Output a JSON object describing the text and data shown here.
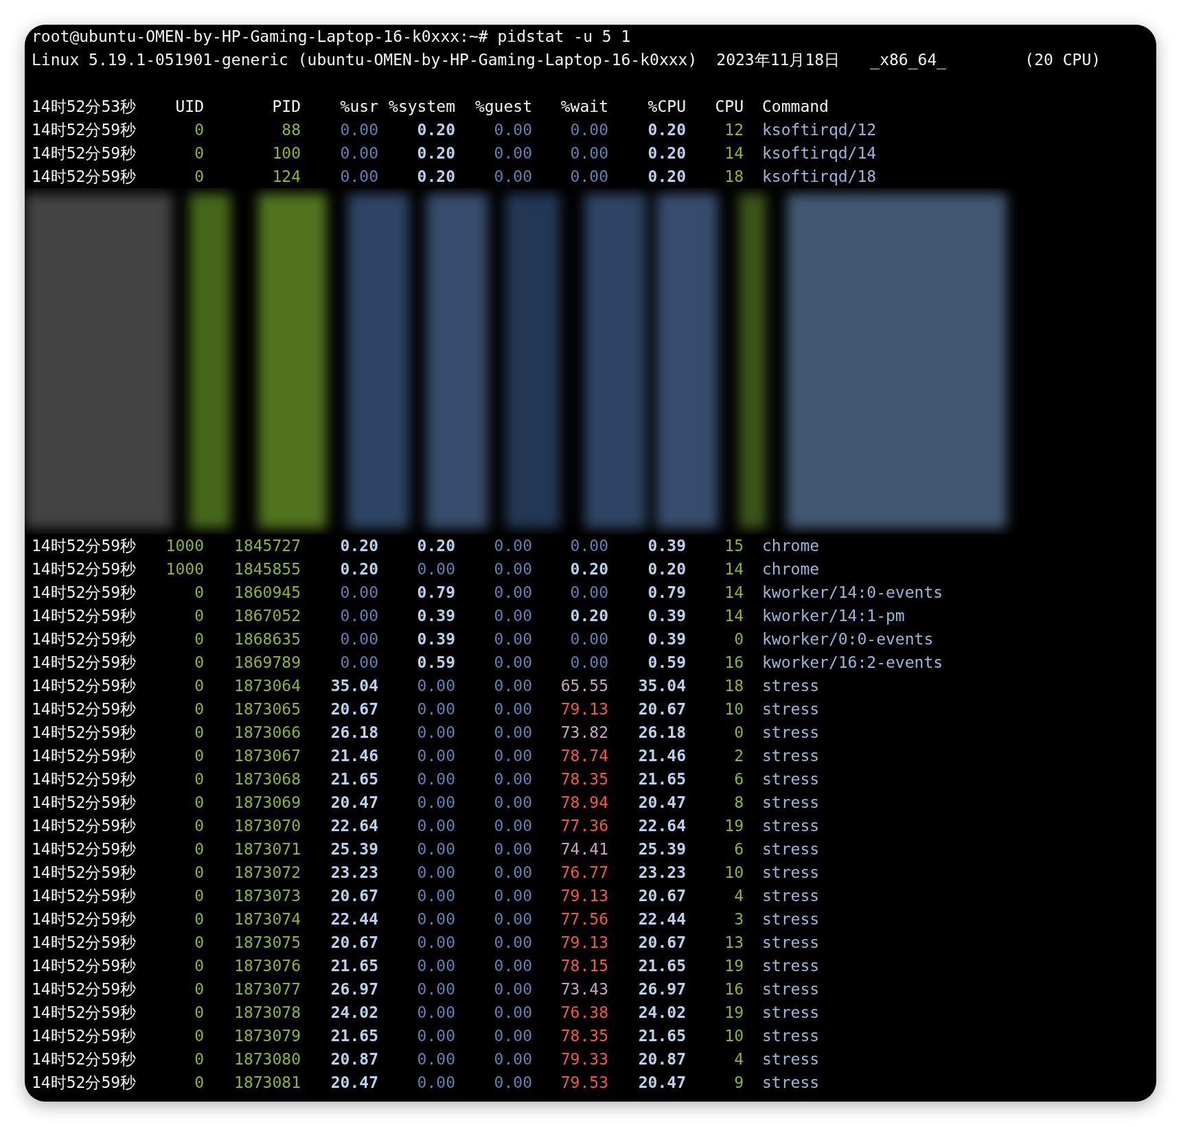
{
  "terminal": {
    "prompt": "root@ubuntu-OMEN-by-HP-Gaming-Laptop-16-k0xxx:~# pidstat -u 5 1",
    "system_info": {
      "kernel": "Linux 5.19.1-051901-generic (ubuntu-OMEN-by-HP-Gaming-Laptop-16-k0xxx)",
      "date": "2023年11月18日",
      "arch": "_x86_64_",
      "cpus": "(20 CPU)"
    },
    "header": [
      "14时52分53秒",
      "UID",
      "PID",
      "%usr",
      "%system",
      "%guest",
      "%wait",
      "%CPU",
      "CPU",
      "Command"
    ],
    "rows": [
      {
        "kind": "process",
        "time": "14时52分59秒",
        "uid": "0",
        "pid": "88",
        "cells": [
          {
            "text": "0.00",
            "kind": "zero"
          },
          {
            "text": "0.20",
            "kind": "value"
          },
          {
            "text": "0.00",
            "kind": "zero"
          },
          {
            "text": "0.00",
            "kind": "zero"
          },
          {
            "text": "0.20",
            "kind": "value"
          }
        ],
        "cpu": "12",
        "command": "ksoftirqd/12"
      },
      {
        "kind": "process",
        "time": "14时52分59秒",
        "uid": "0",
        "pid": "100",
        "cells": [
          {
            "text": "0.00",
            "kind": "zero"
          },
          {
            "text": "0.20",
            "kind": "value"
          },
          {
            "text": "0.00",
            "kind": "zero"
          },
          {
            "text": "0.00",
            "kind": "zero"
          },
          {
            "text": "0.20",
            "kind": "value"
          }
        ],
        "cpu": "14",
        "command": "ksoftirqd/14"
      },
      {
        "kind": "process",
        "time": "14时52分59秒",
        "uid": "0",
        "pid": "124",
        "cells": [
          {
            "text": "0.00",
            "kind": "zero"
          },
          {
            "text": "0.20",
            "kind": "value"
          },
          {
            "text": "0.00",
            "kind": "zero"
          },
          {
            "text": "0.00",
            "kind": "zero"
          },
          {
            "text": "0.20",
            "kind": "value"
          }
        ],
        "cpu": "18",
        "command": "ksoftirqd/18"
      },
      {
        "kind": "blurred"
      },
      {
        "kind": "process",
        "time": "14时52分59秒",
        "uid": "1000",
        "pid": "1845727",
        "cells": [
          {
            "text": "0.20",
            "kind": "value"
          },
          {
            "text": "0.20",
            "kind": "value"
          },
          {
            "text": "0.00",
            "kind": "zero"
          },
          {
            "text": "0.00",
            "kind": "zero"
          },
          {
            "text": "0.39",
            "kind": "value"
          }
        ],
        "cpu": "15",
        "command": "chrome"
      },
      {
        "kind": "process",
        "time": "14时52分59秒",
        "uid": "1000",
        "pid": "1845855",
        "cells": [
          {
            "text": "0.20",
            "kind": "value"
          },
          {
            "text": "0.00",
            "kind": "zero"
          },
          {
            "text": "0.00",
            "kind": "zero"
          },
          {
            "text": "0.20",
            "kind": "value"
          },
          {
            "text": "0.20",
            "kind": "value"
          }
        ],
        "cpu": "14",
        "command": "chrome"
      },
      {
        "kind": "process",
        "time": "14时52分59秒",
        "uid": "0",
        "pid": "1860945",
        "cells": [
          {
            "text": "0.00",
            "kind": "zero"
          },
          {
            "text": "0.79",
            "kind": "value"
          },
          {
            "text": "0.00",
            "kind": "zero"
          },
          {
            "text": "0.00",
            "kind": "zero"
          },
          {
            "text": "0.79",
            "kind": "value"
          }
        ],
        "cpu": "14",
        "command": "kworker/14:0-events"
      },
      {
        "kind": "process",
        "time": "14时52分59秒",
        "uid": "0",
        "pid": "1867052",
        "cells": [
          {
            "text": "0.00",
            "kind": "zero"
          },
          {
            "text": "0.39",
            "kind": "value"
          },
          {
            "text": "0.00",
            "kind": "zero"
          },
          {
            "text": "0.20",
            "kind": "value"
          },
          {
            "text": "0.39",
            "kind": "value"
          }
        ],
        "cpu": "14",
        "command": "kworker/14:1-pm"
      },
      {
        "kind": "process",
        "time": "14时52分59秒",
        "uid": "0",
        "pid": "1868635",
        "cells": [
          {
            "text": "0.00",
            "kind": "zero"
          },
          {
            "text": "0.39",
            "kind": "value"
          },
          {
            "text": "0.00",
            "kind": "zero"
          },
          {
            "text": "0.00",
            "kind": "zero"
          },
          {
            "text": "0.39",
            "kind": "value"
          }
        ],
        "cpu": "0",
        "command": "kworker/0:0-events"
      },
      {
        "kind": "process",
        "time": "14时52分59秒",
        "uid": "0",
        "pid": "1869789",
        "cells": [
          {
            "text": "0.00",
            "kind": "zero"
          },
          {
            "text": "0.59",
            "kind": "value"
          },
          {
            "text": "0.00",
            "kind": "zero"
          },
          {
            "text": "0.00",
            "kind": "zero"
          },
          {
            "text": "0.59",
            "kind": "value"
          }
        ],
        "cpu": "16",
        "command": "kworker/16:2-events"
      },
      {
        "kind": "process",
        "time": "14时52分59秒",
        "uid": "0",
        "pid": "1873064",
        "cells": [
          {
            "text": "35.04",
            "kind": "value"
          },
          {
            "text": "0.00",
            "kind": "zero"
          },
          {
            "text": "0.00",
            "kind": "zero"
          },
          {
            "text": "65.55",
            "kind": "warn"
          },
          {
            "text": "35.04",
            "kind": "value"
          }
        ],
        "cpu": "18",
        "command": "stress"
      },
      {
        "kind": "process",
        "time": "14时52分59秒",
        "uid": "0",
        "pid": "1873065",
        "cells": [
          {
            "text": "20.67",
            "kind": "value"
          },
          {
            "text": "0.00",
            "kind": "zero"
          },
          {
            "text": "0.00",
            "kind": "zero"
          },
          {
            "text": "79.13",
            "kind": "alert"
          },
          {
            "text": "20.67",
            "kind": "value"
          }
        ],
        "cpu": "10",
        "command": "stress"
      },
      {
        "kind": "process",
        "time": "14时52分59秒",
        "uid": "0",
        "pid": "1873066",
        "cells": [
          {
            "text": "26.18",
            "kind": "value"
          },
          {
            "text": "0.00",
            "kind": "zero"
          },
          {
            "text": "0.00",
            "kind": "zero"
          },
          {
            "text": "73.82",
            "kind": "warn"
          },
          {
            "text": "26.18",
            "kind": "value"
          }
        ],
        "cpu": "0",
        "command": "stress"
      },
      {
        "kind": "process",
        "time": "14时52分59秒",
        "uid": "0",
        "pid": "1873067",
        "cells": [
          {
            "text": "21.46",
            "kind": "value"
          },
          {
            "text": "0.00",
            "kind": "zero"
          },
          {
            "text": "0.00",
            "kind": "zero"
          },
          {
            "text": "78.74",
            "kind": "alert"
          },
          {
            "text": "21.46",
            "kind": "value"
          }
        ],
        "cpu": "2",
        "command": "stress"
      },
      {
        "kind": "process",
        "time": "14时52分59秒",
        "uid": "0",
        "pid": "1873068",
        "cells": [
          {
            "text": "21.65",
            "kind": "value"
          },
          {
            "text": "0.00",
            "kind": "zero"
          },
          {
            "text": "0.00",
            "kind": "zero"
          },
          {
            "text": "78.35",
            "kind": "alert"
          },
          {
            "text": "21.65",
            "kind": "value"
          }
        ],
        "cpu": "6",
        "command": "stress"
      },
      {
        "kind": "process",
        "time": "14时52分59秒",
        "uid": "0",
        "pid": "1873069",
        "cells": [
          {
            "text": "20.47",
            "kind": "value"
          },
          {
            "text": "0.00",
            "kind": "zero"
          },
          {
            "text": "0.00",
            "kind": "zero"
          },
          {
            "text": "78.94",
            "kind": "alert"
          },
          {
            "text": "20.47",
            "kind": "value"
          }
        ],
        "cpu": "8",
        "command": "stress"
      },
      {
        "kind": "process",
        "time": "14时52分59秒",
        "uid": "0",
        "pid": "1873070",
        "cells": [
          {
            "text": "22.64",
            "kind": "value"
          },
          {
            "text": "0.00",
            "kind": "zero"
          },
          {
            "text": "0.00",
            "kind": "zero"
          },
          {
            "text": "77.36",
            "kind": "alert"
          },
          {
            "text": "22.64",
            "kind": "value"
          }
        ],
        "cpu": "19",
        "command": "stress"
      },
      {
        "kind": "process",
        "time": "14时52分59秒",
        "uid": "0",
        "pid": "1873071",
        "cells": [
          {
            "text": "25.39",
            "kind": "value"
          },
          {
            "text": "0.00",
            "kind": "zero"
          },
          {
            "text": "0.00",
            "kind": "zero"
          },
          {
            "text": "74.41",
            "kind": "warn"
          },
          {
            "text": "25.39",
            "kind": "value"
          }
        ],
        "cpu": "6",
        "command": "stress"
      },
      {
        "kind": "process",
        "time": "14时52分59秒",
        "uid": "0",
        "pid": "1873072",
        "cells": [
          {
            "text": "23.23",
            "kind": "value"
          },
          {
            "text": "0.00",
            "kind": "zero"
          },
          {
            "text": "0.00",
            "kind": "zero"
          },
          {
            "text": "76.77",
            "kind": "alert"
          },
          {
            "text": "23.23",
            "kind": "value"
          }
        ],
        "cpu": "10",
        "command": "stress"
      },
      {
        "kind": "process",
        "time": "14时52分59秒",
        "uid": "0",
        "pid": "1873073",
        "cells": [
          {
            "text": "20.67",
            "kind": "value"
          },
          {
            "text": "0.00",
            "kind": "zero"
          },
          {
            "text": "0.00",
            "kind": "zero"
          },
          {
            "text": "79.13",
            "kind": "alert"
          },
          {
            "text": "20.67",
            "kind": "value"
          }
        ],
        "cpu": "4",
        "command": "stress"
      },
      {
        "kind": "process",
        "time": "14时52分59秒",
        "uid": "0",
        "pid": "1873074",
        "cells": [
          {
            "text": "22.44",
            "kind": "value"
          },
          {
            "text": "0.00",
            "kind": "zero"
          },
          {
            "text": "0.00",
            "kind": "zero"
          },
          {
            "text": "77.56",
            "kind": "alert"
          },
          {
            "text": "22.44",
            "kind": "value"
          }
        ],
        "cpu": "3",
        "command": "stress"
      },
      {
        "kind": "process",
        "time": "14时52分59秒",
        "uid": "0",
        "pid": "1873075",
        "cells": [
          {
            "text": "20.67",
            "kind": "value"
          },
          {
            "text": "0.00",
            "kind": "zero"
          },
          {
            "text": "0.00",
            "kind": "zero"
          },
          {
            "text": "79.13",
            "kind": "alert"
          },
          {
            "text": "20.67",
            "kind": "value"
          }
        ],
        "cpu": "13",
        "command": "stress"
      },
      {
        "kind": "process",
        "time": "14时52分59秒",
        "uid": "0",
        "pid": "1873076",
        "cells": [
          {
            "text": "21.65",
            "kind": "value"
          },
          {
            "text": "0.00",
            "kind": "zero"
          },
          {
            "text": "0.00",
            "kind": "zero"
          },
          {
            "text": "78.15",
            "kind": "alert"
          },
          {
            "text": "21.65",
            "kind": "value"
          }
        ],
        "cpu": "19",
        "command": "stress"
      },
      {
        "kind": "process",
        "time": "14时52分59秒",
        "uid": "0",
        "pid": "1873077",
        "cells": [
          {
            "text": "26.97",
            "kind": "value"
          },
          {
            "text": "0.00",
            "kind": "zero"
          },
          {
            "text": "0.00",
            "kind": "zero"
          },
          {
            "text": "73.43",
            "kind": "warn"
          },
          {
            "text": "26.97",
            "kind": "value"
          }
        ],
        "cpu": "16",
        "command": "stress"
      },
      {
        "kind": "process",
        "time": "14时52分59秒",
        "uid": "0",
        "pid": "1873078",
        "cells": [
          {
            "text": "24.02",
            "kind": "value"
          },
          {
            "text": "0.00",
            "kind": "zero"
          },
          {
            "text": "0.00",
            "kind": "zero"
          },
          {
            "text": "76.38",
            "kind": "alert"
          },
          {
            "text": "24.02",
            "kind": "value"
          }
        ],
        "cpu": "19",
        "command": "stress"
      },
      {
        "kind": "process",
        "time": "14时52分59秒",
        "uid": "0",
        "pid": "1873079",
        "cells": [
          {
            "text": "21.65",
            "kind": "value"
          },
          {
            "text": "0.00",
            "kind": "zero"
          },
          {
            "text": "0.00",
            "kind": "zero"
          },
          {
            "text": "78.35",
            "kind": "alert"
          },
          {
            "text": "21.65",
            "kind": "value"
          }
        ],
        "cpu": "10",
        "command": "stress"
      },
      {
        "kind": "process",
        "time": "14时52分59秒",
        "uid": "0",
        "pid": "1873080",
        "cells": [
          {
            "text": "20.87",
            "kind": "value"
          },
          {
            "text": "0.00",
            "kind": "zero"
          },
          {
            "text": "0.00",
            "kind": "zero"
          },
          {
            "text": "79.33",
            "kind": "alert"
          },
          {
            "text": "20.87",
            "kind": "value"
          }
        ],
        "cpu": "4",
        "command": "stress"
      },
      {
        "kind": "process",
        "time": "14时52分59秒",
        "uid": "0",
        "pid": "1873081",
        "cells": [
          {
            "text": "20.47",
            "kind": "value"
          },
          {
            "text": "0.00",
            "kind": "zero"
          },
          {
            "text": "0.00",
            "kind": "zero"
          },
          {
            "text": "79.53",
            "kind": "alert"
          },
          {
            "text": "20.47",
            "kind": "value"
          }
        ],
        "cpu": "9",
        "command": "stress"
      }
    ]
  }
}
